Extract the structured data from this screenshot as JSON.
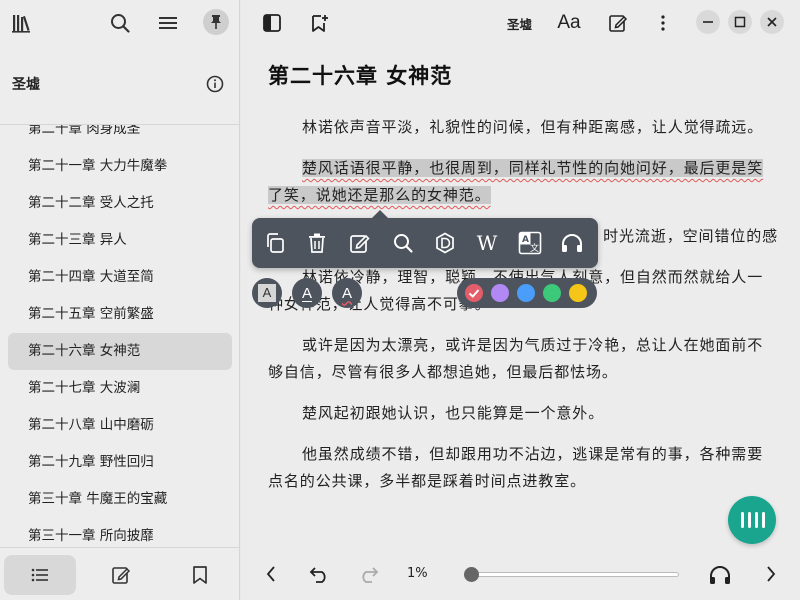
{
  "sidebar": {
    "book_title": "圣墟",
    "chapters": [
      {
        "label": "第二十章 肉身成圣"
      },
      {
        "label": "第二十一章 大力牛魔拳"
      },
      {
        "label": "第二十二章 受人之托"
      },
      {
        "label": "第二十三章 异人"
      },
      {
        "label": "第二十四章 大道至简"
      },
      {
        "label": "第二十五章 空前繁盛"
      },
      {
        "label": "第二十六章 女神范",
        "active": true
      },
      {
        "label": "第二十七章 大波澜"
      },
      {
        "label": "第二十八章 山中磨砺"
      },
      {
        "label": "第二十九章 野性回归"
      },
      {
        "label": "第三十章 牛魔王的宝藏"
      },
      {
        "label": "第三十一章 所向披靡"
      }
    ],
    "top_icons": [
      "library-icon",
      "search-icon",
      "menu-icon",
      "pin-icon"
    ],
    "bottom_tabs": [
      "toc-icon",
      "notes-icon",
      "bookmark-icon"
    ]
  },
  "reader": {
    "book_name": "圣墟",
    "font_icon_label": "Aa",
    "chapter_title": "第二十六章 女神范",
    "paragraphs": [
      {
        "pre": "林诺依声音平淡，礼貌性的问候，但有种距离感，让人觉得疏远。",
        "hl": "",
        "post": ""
      },
      {
        "pre": "",
        "hl": "楚风话语很平静，也很周到，同样礼节性的向她问好，最后更是笑了笑，说她还是那么的女神范。",
        "post": ""
      },
      {
        "pre": "时光流逝，空间错位的感",
        "hl": "",
        "post": ""
      },
      {
        "pre": "林诺依冷静，理智，聪颖，不使出气人刻意，但自然而然就给人一种女神范，让人觉得高不可攀。",
        "hl": "",
        "post": ""
      },
      {
        "pre": "或许是因为太漂亮，或许是因为气质过于冷艳，总让人在她面前不够自信，尽管有很多人都想追她，但最后都怯场。",
        "hl": "",
        "post": ""
      },
      {
        "pre": "楚风起初跟她认识，也只能算是一个意外。",
        "hl": "",
        "post": ""
      },
      {
        "pre": "他虽然成绩不错，但却跟用功不沾边，逃课是常有的事，各种需要点名的公共课，多半都是踩着时间点进教室。",
        "hl": "",
        "post": ""
      }
    ],
    "progress_label": "1%",
    "progress_value": 0.01
  },
  "popup": {
    "tools": [
      "copy-icon",
      "delete-icon",
      "edit-note-icon",
      "search-icon",
      "dictionary-icon",
      "wikipedia-icon",
      "translate-icon",
      "read-aloud-icon"
    ],
    "wiki_glyph": "W",
    "style_glyph": "A",
    "colors": [
      "#e35d6a",
      "#b288f5",
      "#4a9df8",
      "#3cc97a",
      "#f5c518"
    ]
  },
  "colors": {
    "accent": "#1aa58f",
    "popup_bg": "#4d545e",
    "highlight_underline": "#e05a5a"
  }
}
